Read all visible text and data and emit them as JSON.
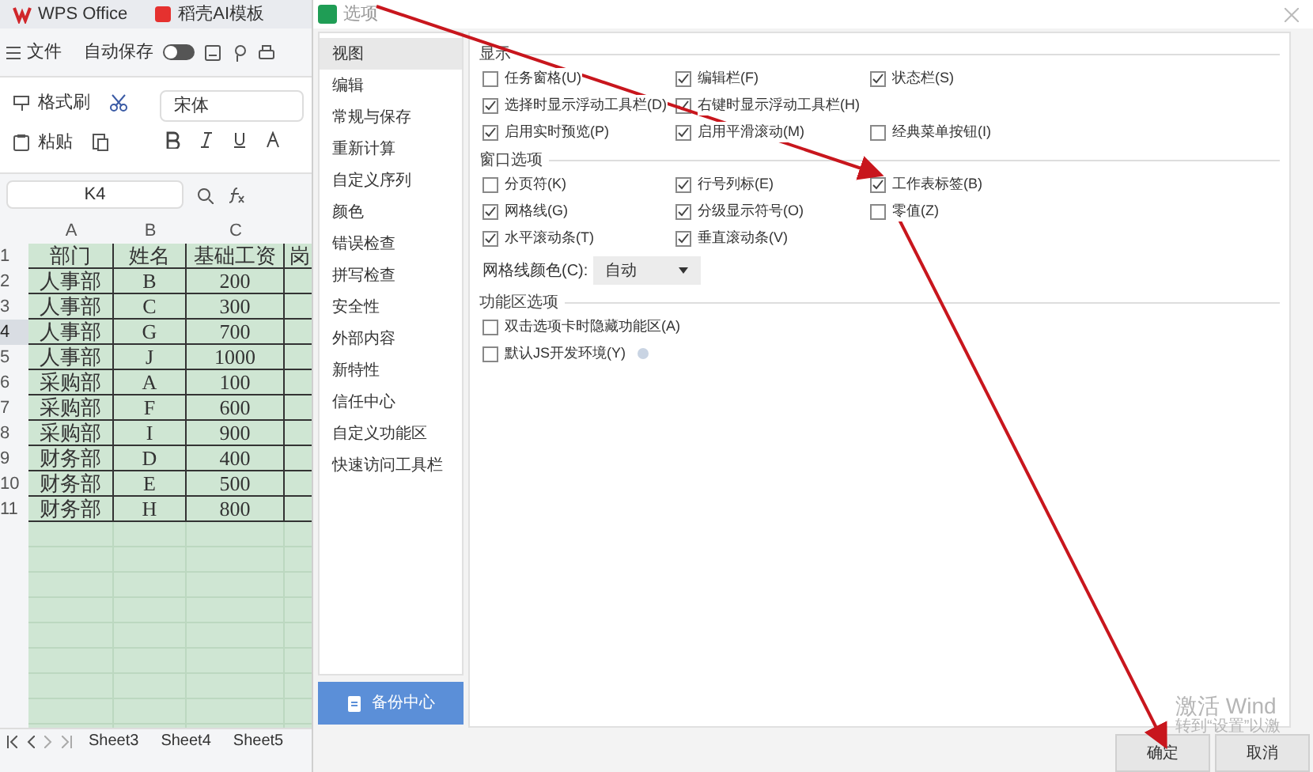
{
  "app_tabs": [
    {
      "label": "WPS Office",
      "selected": false
    },
    {
      "label": "稻壳AI模板",
      "selected": false
    }
  ],
  "toolbar": {
    "file_menu": "文件",
    "autosave_label": "自动保存",
    "autosave_on": false
  },
  "ribbon": {
    "format_painter": "格式刷",
    "paste": "粘贴",
    "font_name": "宋体"
  },
  "name_box": "K4",
  "sheet": {
    "columns": [
      "A",
      "B",
      "C"
    ],
    "rows": [
      {
        "number": "1",
        "selected": false,
        "cells": [
          "部门",
          "姓名",
          "基础工资",
          "岗"
        ]
      },
      {
        "number": "2",
        "selected": false,
        "cells": [
          "人事部",
          "B",
          "200"
        ]
      },
      {
        "number": "3",
        "selected": false,
        "cells": [
          "人事部",
          "C",
          "300"
        ]
      },
      {
        "number": "4",
        "selected": true,
        "cells": [
          "人事部",
          "G",
          "700"
        ]
      },
      {
        "number": "5",
        "selected": false,
        "cells": [
          "人事部",
          "J",
          "1000"
        ]
      },
      {
        "number": "6",
        "selected": false,
        "cells": [
          "采购部",
          "A",
          "100"
        ]
      },
      {
        "number": "7",
        "selected": false,
        "cells": [
          "采购部",
          "F",
          "600"
        ]
      },
      {
        "number": "8",
        "selected": false,
        "cells": [
          "采购部",
          "I",
          "900"
        ]
      },
      {
        "number": "9",
        "selected": false,
        "cells": [
          "财务部",
          "D",
          "400"
        ]
      },
      {
        "number": "10",
        "selected": false,
        "cells": [
          "财务部",
          "E",
          "500"
        ]
      },
      {
        "number": "11",
        "selected": false,
        "cells": [
          "财务部",
          "H",
          "800"
        ]
      }
    ]
  },
  "sheet_tabs": [
    {
      "label": "Sheet3",
      "selected": false
    },
    {
      "label": "Sheet4",
      "selected": false
    },
    {
      "label": "Sheet5",
      "selected": false
    }
  ],
  "dialog": {
    "title": "选项",
    "nav": [
      {
        "label": "视图",
        "selected": true
      },
      {
        "label": "编辑",
        "selected": false
      },
      {
        "label": "常规与保存",
        "selected": false
      },
      {
        "label": "重新计算",
        "selected": false
      },
      {
        "label": "自定义序列",
        "selected": false
      },
      {
        "label": "颜色",
        "selected": false
      },
      {
        "label": "错误检查",
        "selected": false
      },
      {
        "label": "拼写检查",
        "selected": false
      },
      {
        "label": "安全性",
        "selected": false
      },
      {
        "label": "外部内容",
        "selected": false
      },
      {
        "label": "新特性",
        "selected": false
      },
      {
        "label": "信任中心",
        "selected": false
      },
      {
        "label": "自定义功能区",
        "selected": false
      },
      {
        "label": "快速访问工具栏",
        "selected": false
      }
    ],
    "sections": [
      {
        "title": "显示",
        "options": [
          {
            "label": "任务窗格(U)",
            "checked": false
          },
          {
            "label": "编辑栏(F)",
            "checked": true
          },
          {
            "label": "状态栏(S)",
            "checked": true
          },
          {
            "label": "选择时显示浮动工具栏(D)",
            "checked": true
          },
          {
            "label": "右键时显示浮动工具栏(H)",
            "checked": true
          },
          {
            "kind": "blank"
          },
          {
            "label": "启用实时预览(P)",
            "checked": true
          },
          {
            "label": "启用平滑滚动(M)",
            "checked": true
          },
          {
            "label": "经典菜单按钮(I)",
            "checked": false
          }
        ]
      },
      {
        "title": "窗口选项",
        "options": [
          {
            "label": "分页符(K)",
            "checked": false
          },
          {
            "label": "行号列标(E)",
            "checked": true
          },
          {
            "label": "工作表标签(B)",
            "checked": true
          },
          {
            "label": "网格线(G)",
            "checked": true
          },
          {
            "label": "分级显示符号(O)",
            "checked": true
          },
          {
            "label": "零值(Z)",
            "checked": false
          },
          {
            "label": "水平滚动条(T)",
            "checked": true
          },
          {
            "label": "垂直滚动条(V)",
            "checked": true
          }
        ],
        "gridline_color": {
          "label": "网格线颜色(C):",
          "value": "自动"
        }
      },
      {
        "title": "功能区选项",
        "options": [
          {
            "label": "双击选项卡时隐藏功能区(A)",
            "checked": false
          },
          {
            "kind": "blank"
          },
          {
            "kind": "blank"
          },
          {
            "label": "默认JS开发环境(Y)",
            "checked": false,
            "info": true
          }
        ]
      }
    ],
    "backup_button": "备份中心",
    "buttons": [
      "确定",
      "取消"
    ]
  },
  "activation_notice": {
    "title": "激活 Wind",
    "subtitle": "转到“设置”以激"
  }
}
